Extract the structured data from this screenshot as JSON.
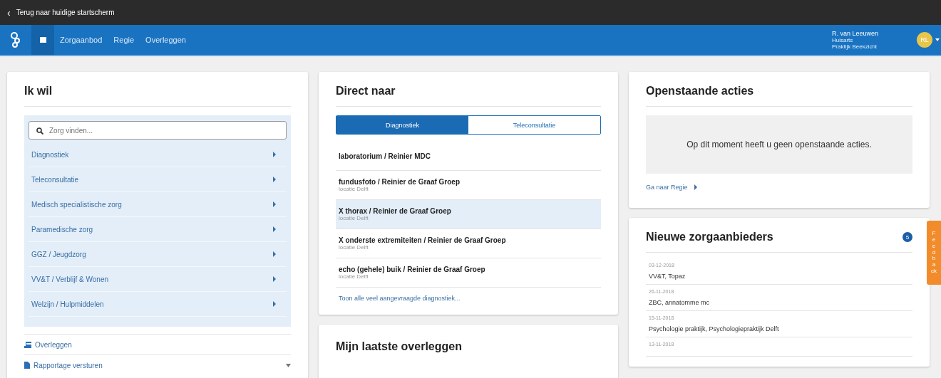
{
  "back_bar": {
    "arrow": "‹",
    "label": "Terug naar huidige startscherm"
  },
  "nav": {
    "items": [
      {
        "label": "Zorgaanbod",
        "selected": false
      },
      {
        "label": "Regie",
        "selected": false
      },
      {
        "label": "Overleggen",
        "selected": false
      }
    ],
    "home_selected": true
  },
  "user": {
    "name": "R. van Leeuwen",
    "role": "Huisarts",
    "practice": "Praktijk Beekzicht",
    "initials": "RL"
  },
  "ik_wil": {
    "title": "Ik wil",
    "search": {
      "placeholder": "Zorg vinden..."
    },
    "categories": [
      "Diagnostiek",
      "Teleconsultatie",
      "Medisch specialistische zorg",
      "Paramedische zorg",
      "GGZ / Jeugdzorg",
      "VV&T / Verblijf & Wonen",
      "Welzijn / Hulpmiddelen"
    ],
    "actions": [
      {
        "kind": "link",
        "label": "Overleggen"
      },
      {
        "kind": "dropdown",
        "label": "Rapportage versturen"
      }
    ]
  },
  "direct_naar": {
    "title": "Direct naar",
    "tabs": [
      {
        "label": "Diagnostiek",
        "selected": true
      },
      {
        "label": "Teleconsultatie",
        "selected": false
      }
    ],
    "items": [
      {
        "title": "laboratorium / Reinier MDC",
        "selected": false
      },
      {
        "title": "fundusfoto / Reinier de Graaf Groep",
        "subtitle": "locatie Delft",
        "selected": false
      },
      {
        "title": "X thorax / Reinier de Graaf Groep",
        "subtitle": "locatie Delft",
        "selected": true
      },
      {
        "title": "X onderste extremiteiten / Reinier de Graaf Groep",
        "subtitle": "locatie Delft",
        "selected": false
      },
      {
        "title": "echo (gehele) buik / Reinier de Graaf Groep",
        "subtitle": "locatie Delft",
        "selected": false
      }
    ],
    "more_link": "Toon alle veel aangevraagde diagnostiek..."
  },
  "overleggen": {
    "title": "Mijn laatste overleggen"
  },
  "openstaande_acties": {
    "title": "Openstaande acties",
    "message": "Op dit moment heeft u geen openstaande acties.",
    "link": "Ga naar Regie"
  },
  "nieuwe_zorgaanbieders": {
    "title": "Nieuwe zorgaanbieders",
    "badge": "5",
    "items": [
      {
        "date": "03-12-2018",
        "name": "VV&T, Topaz"
      },
      {
        "date": "26-11-2018",
        "name": "ZBC, annatomme mc"
      },
      {
        "date": "15-11-2018",
        "name": "Psychologie praktijk, Psychologiepraktijk Delft"
      },
      {
        "date": "13-11-2018"
      }
    ]
  },
  "feedback": "Feedback"
}
